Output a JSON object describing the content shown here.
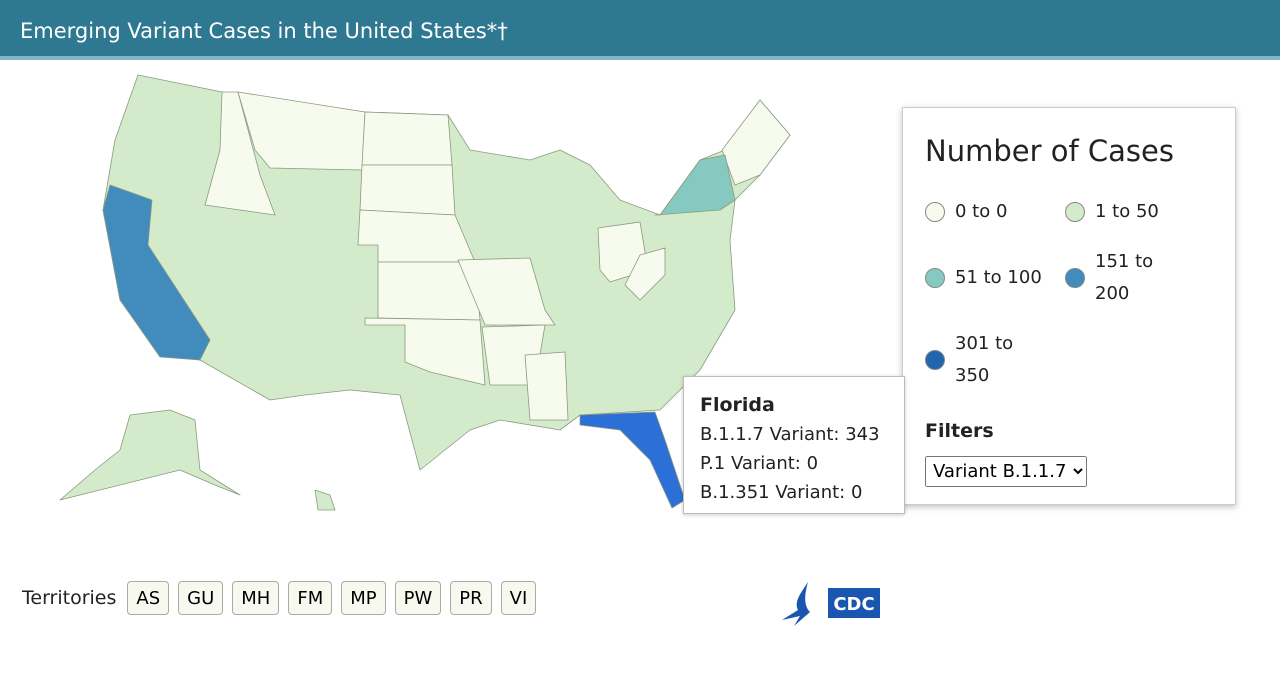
{
  "header": {
    "title": "Emerging Variant Cases in the United States*†"
  },
  "legend": {
    "title": "Number of Cases",
    "items": [
      {
        "label": "0 to 0",
        "color": "#f7fbee"
      },
      {
        "label": "1 to 50",
        "color": "#d3ebca"
      },
      {
        "label": "51 to 100",
        "color": "#86c9c0"
      },
      {
        "label": "151 to 200",
        "color": "#418bbd"
      },
      {
        "label": "301 to 350",
        "color": "#2166ac"
      }
    ],
    "filters_label": "Filters",
    "filter_value": "Variant B.1.1.7"
  },
  "map": {
    "highlight_color": "#2c6fd6",
    "states": {
      "CA": "151 to 200",
      "FL": "301 to 350",
      "NY": "51 to 100",
      "ID": "0 to 0",
      "MT": "0 to 0",
      "ND": "0 to 0",
      "SD": "0 to 0",
      "NE": "0 to 0",
      "KS": "0 to 0",
      "OK": "0 to 0",
      "MO": "0 to 0",
      "AR": "0 to 0",
      "MS": "0 to 0",
      "OH": "0 to 0",
      "WV": "0 to 0",
      "ME": "0 to 0",
      "NH": "0 to 0",
      "VT": "0 to 0"
    },
    "other_states": "1 to 50"
  },
  "tooltip": {
    "state": "Florida",
    "lines": [
      "B.1.1.7 Variant: 343",
      "P.1 Variant: 0",
      "B.1.351 Variant: 0"
    ]
  },
  "territories": {
    "label": "Territories",
    "items": [
      "AS",
      "GU",
      "MH",
      "FM",
      "MP",
      "PW",
      "PR",
      "VI"
    ]
  },
  "logo": {
    "text": "CDC"
  }
}
